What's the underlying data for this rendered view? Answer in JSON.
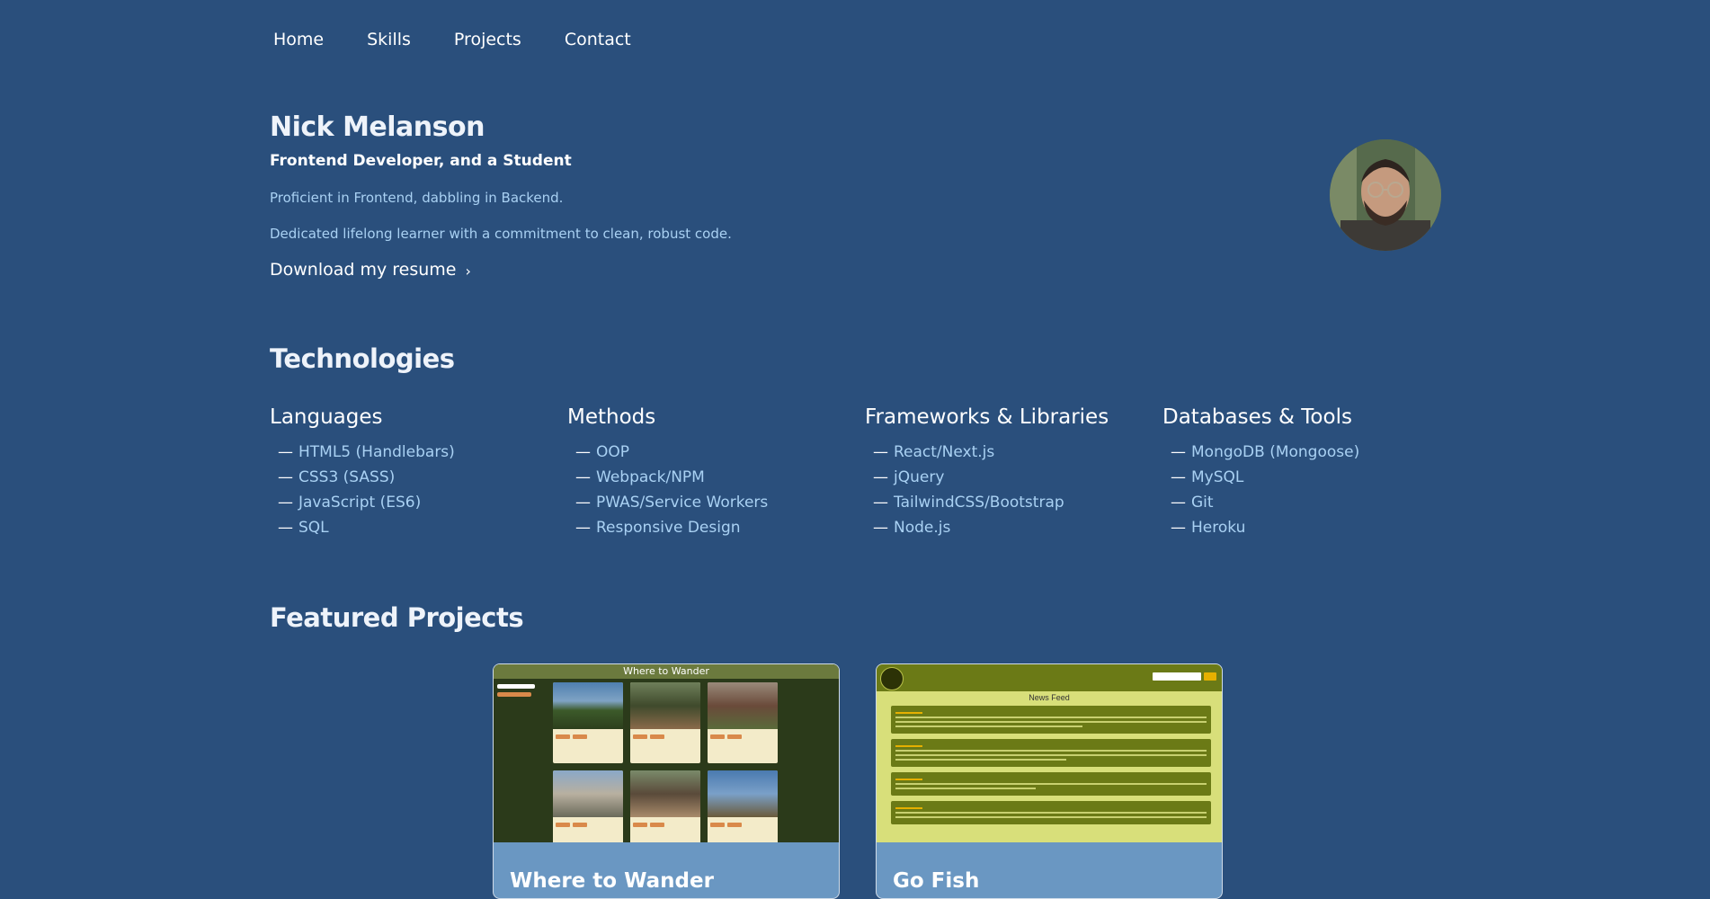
{
  "nav": {
    "items": [
      "Home",
      "Skills",
      "Projects",
      "Contact"
    ]
  },
  "hero": {
    "name": "Nick Melanson",
    "subtitle": "Frontend Developer, and a Student",
    "line1": "Proficient in Frontend, dabbling in Backend.",
    "line2": "Dedicated lifelong learner with a commitment to clean, robust code.",
    "resume_label": "Download my resume",
    "resume_icon": "chevron-right-icon"
  },
  "technologies": {
    "title": "Technologies",
    "columns": [
      {
        "heading": "Languages",
        "items": [
          "HTML5 (Handlebars)",
          "CSS3 (SASS)",
          "JavaScript (ES6)",
          "SQL"
        ]
      },
      {
        "heading": "Methods",
        "items": [
          "OOP",
          "Webpack/NPM",
          "PWAS/Service Workers",
          "Responsive Design"
        ]
      },
      {
        "heading": "Frameworks & Libraries",
        "items": [
          "React/Next.js",
          "jQuery",
          "TailwindCSS/Bootstrap",
          "Node.js"
        ]
      },
      {
        "heading": "Databases & Tools",
        "items": [
          "MongoDB (Mongoose)",
          "MySQL",
          "Git",
          "Heroku"
        ]
      }
    ]
  },
  "featured": {
    "title": "Featured Projects",
    "projects": [
      {
        "name": "Where to Wander",
        "screenshot_title": "Where to Wander"
      },
      {
        "name": "Go Fish",
        "screenshot_title": "News Feed"
      }
    ]
  },
  "colors": {
    "background": "#2a4f7c",
    "link": "#a9d1f3",
    "card": "#6a97c2"
  }
}
